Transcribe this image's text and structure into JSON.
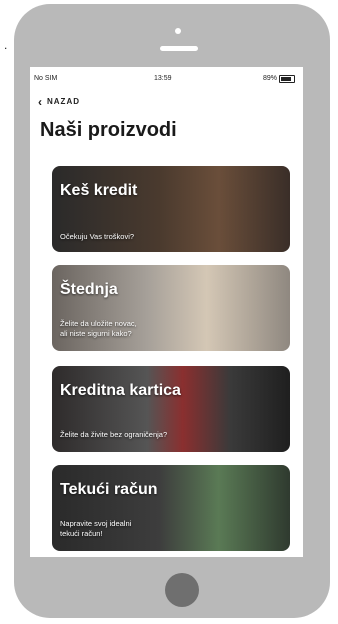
{
  "status_bar": {
    "carrier": "No SIM",
    "time": "13:59",
    "battery": "89%"
  },
  "nav": {
    "back_label": "NAZAD"
  },
  "page": {
    "title": "Naši proizvodi"
  },
  "cards": [
    {
      "title": "Keš kredit",
      "subtitle": "Očekuju Vas troškovi?"
    },
    {
      "title": "Štednja",
      "subtitle": "Želite da uložite novac,\nali niste sigurni kako?"
    },
    {
      "title": "Kreditna kartica",
      "subtitle": "Želite da živite bez ograničenja?"
    },
    {
      "title": "Tekući račun",
      "subtitle": "Napravite svoj idealni\ntekući račun!"
    }
  ]
}
